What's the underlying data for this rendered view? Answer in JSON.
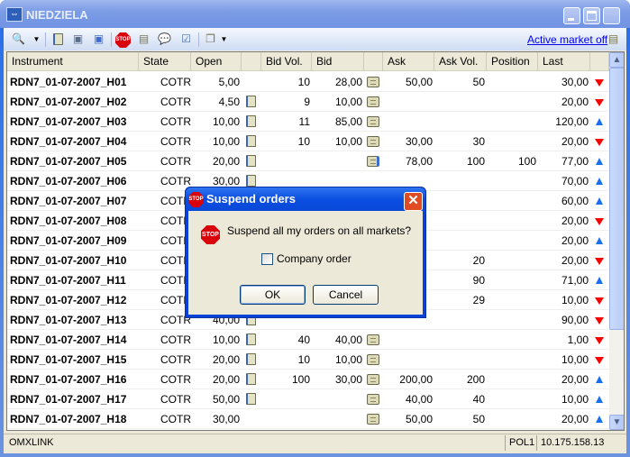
{
  "window": {
    "title": "NIEDZIELA",
    "app_icon": "arrows-icon"
  },
  "toolbar": {
    "icons": [
      "search-icon",
      "notebook-icon",
      "order-icon",
      "add-order-icon",
      "stop-icon",
      "columns-icon",
      "comment-icon",
      "checklist-icon",
      "windows-icon"
    ],
    "active_market_link": "Active market off",
    "stop_text": "STOP"
  },
  "table": {
    "columns": [
      "Instrument",
      "State",
      "Open",
      "",
      "Bid Vol.",
      "Bid",
      "",
      "Ask",
      "Ask Vol.",
      "Position",
      "Last",
      ""
    ],
    "rows": [
      {
        "instrument": "RDN7_01-07-2007_H01",
        "state": "COTR",
        "open": "5,00",
        "open_icon": false,
        "bid_vol": "10",
        "bid": "28,00",
        "bid_icon": "folder",
        "ask": "50,00",
        "ask_vol": "50",
        "position": "",
        "last": "30,00",
        "trend": "down"
      },
      {
        "instrument": "RDN7_01-07-2007_H02",
        "state": "COTR",
        "open": "4,50",
        "open_icon": true,
        "bid_vol": "9",
        "bid": "10,00",
        "bid_icon": "folder",
        "ask": "",
        "ask_vol": "",
        "position": "",
        "last": "20,00",
        "trend": "down"
      },
      {
        "instrument": "RDN7_01-07-2007_H03",
        "state": "COTR",
        "open": "10,00",
        "open_icon": true,
        "bid_vol": "11",
        "bid": "85,00",
        "bid_icon": "folder",
        "ask": "",
        "ask_vol": "",
        "position": "",
        "last": "120,00",
        "trend": "up"
      },
      {
        "instrument": "RDN7_01-07-2007_H04",
        "state": "COTR",
        "open": "10,00",
        "open_icon": true,
        "bid_vol": "10",
        "bid": "10,00",
        "bid_icon": "folder",
        "ask": "30,00",
        "ask_vol": "30",
        "position": "",
        "last": "20,00",
        "trend": "down"
      },
      {
        "instrument": "RDN7_01-07-2007_H05",
        "state": "COTR",
        "open": "20,00",
        "open_icon": true,
        "bid_vol": "",
        "bid": "",
        "bid_icon": "folder-info",
        "ask": "78,00",
        "ask_vol": "100",
        "position": "100",
        "last": "77,00",
        "trend": "up"
      },
      {
        "instrument": "RDN7_01-07-2007_H06",
        "state": "COTR",
        "open": "30,00",
        "open_icon": true,
        "bid_vol": "",
        "bid": "",
        "bid_icon": "",
        "ask": "",
        "ask_vol": "",
        "position": "",
        "last": "70,00",
        "trend": "up"
      },
      {
        "instrument": "RDN7_01-07-2007_H07",
        "state": "COTR",
        "open": "",
        "open_icon": false,
        "bid_vol": "",
        "bid": "",
        "bid_icon": "",
        "ask": "",
        "ask_vol": "",
        "position": "",
        "last": "60,00",
        "trend": "up"
      },
      {
        "instrument": "RDN7_01-07-2007_H08",
        "state": "COTR",
        "open": "",
        "open_icon": false,
        "bid_vol": "",
        "bid": "",
        "bid_icon": "",
        "ask": "",
        "ask_vol": "",
        "position": "",
        "last": "20,00",
        "trend": "down"
      },
      {
        "instrument": "RDN7_01-07-2007_H09",
        "state": "COTR",
        "open": "",
        "open_icon": false,
        "bid_vol": "",
        "bid": "",
        "bid_icon": "",
        "ask": "",
        "ask_vol": "",
        "position": "",
        "last": "20,00",
        "trend": "up"
      },
      {
        "instrument": "RDN7_01-07-2007_H10",
        "state": "COTR",
        "open": "",
        "open_icon": false,
        "bid_vol": "",
        "bid": "",
        "bid_icon": "",
        "ask": "",
        "ask_vol": "20",
        "position": "",
        "last": "20,00",
        "trend": "down"
      },
      {
        "instrument": "RDN7_01-07-2007_H11",
        "state": "COTR",
        "open": "",
        "open_icon": false,
        "bid_vol": "",
        "bid": "",
        "bid_icon": "",
        "ask": "",
        "ask_vol": "90",
        "position": "",
        "last": "71,00",
        "trend": "up"
      },
      {
        "instrument": "RDN7_01-07-2007_H12",
        "state": "COTR",
        "open": "",
        "open_icon": false,
        "bid_vol": "",
        "bid": "",
        "bid_icon": "",
        "ask": "",
        "ask_vol": "29",
        "position": "",
        "last": "10,00",
        "trend": "down"
      },
      {
        "instrument": "RDN7_01-07-2007_H13",
        "state": "COTR",
        "open": "40,00",
        "open_icon": true,
        "bid_vol": "",
        "bid": "",
        "bid_icon": "",
        "ask": "",
        "ask_vol": "",
        "position": "",
        "last": "90,00",
        "trend": "down"
      },
      {
        "instrument": "RDN7_01-07-2007_H14",
        "state": "COTR",
        "open": "10,00",
        "open_icon": true,
        "bid_vol": "40",
        "bid": "40,00",
        "bid_icon": "folder",
        "ask": "",
        "ask_vol": "",
        "position": "",
        "last": "1,00",
        "trend": "down"
      },
      {
        "instrument": "RDN7_01-07-2007_H15",
        "state": "COTR",
        "open": "20,00",
        "open_icon": true,
        "bid_vol": "10",
        "bid": "10,00",
        "bid_icon": "folder",
        "ask": "",
        "ask_vol": "",
        "position": "",
        "last": "10,00",
        "trend": "down"
      },
      {
        "instrument": "RDN7_01-07-2007_H16",
        "state": "COTR",
        "open": "20,00",
        "open_icon": true,
        "bid_vol": "100",
        "bid": "30,00",
        "bid_icon": "folder",
        "ask": "200,00",
        "ask_vol": "200",
        "position": "",
        "last": "20,00",
        "trend": "up"
      },
      {
        "instrument": "RDN7_01-07-2007_H17",
        "state": "COTR",
        "open": "50,00",
        "open_icon": true,
        "bid_vol": "",
        "bid": "",
        "bid_icon": "folder",
        "ask": "40,00",
        "ask_vol": "40",
        "position": "",
        "last": "10,00",
        "trend": "up"
      },
      {
        "instrument": "RDN7_01-07-2007_H18",
        "state": "COTR",
        "open": "30,00",
        "open_icon": false,
        "bid_vol": "",
        "bid": "",
        "bid_icon": "folder",
        "ask": "50,00",
        "ask_vol": "50",
        "position": "",
        "last": "20,00",
        "trend": "up"
      }
    ],
    "trend_colors": {
      "up": "#1a6ff0",
      "down": "#ff0000"
    }
  },
  "status": {
    "connection": "OMXLINK",
    "market": "POL1",
    "ip": "10.175.158.13"
  },
  "dialog": {
    "title": "Suspend orders",
    "message": "Suspend all my orders on all markets?",
    "checkbox_label": "Company order",
    "checkbox_checked": false,
    "ok": "OK",
    "cancel": "Cancel",
    "stop_text": "STOP"
  }
}
